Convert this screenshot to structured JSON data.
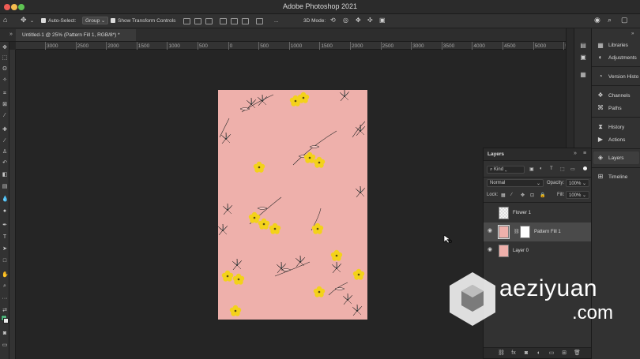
{
  "app": {
    "title": "Adobe Photoshop 2021"
  },
  "options_bar": {
    "auto_select_label": "Auto-Select:",
    "auto_select_value": "Group",
    "transform_controls_label": "Show Transform Controls",
    "mode_3d_label": "3D Mode:",
    "ellipsis": "..."
  },
  "document_tab": {
    "label": "Untitled-1 @ 25% (Pattern Fill 1, RGB/8*) *",
    "close": "×"
  },
  "ruler": {
    "ticks": [
      "3000",
      "2500",
      "2000",
      "1500",
      "1000",
      "500",
      "0",
      "500",
      "1000",
      "1500",
      "2000",
      "2500",
      "3000",
      "3500",
      "4000",
      "4500",
      "5000",
      "5500"
    ]
  },
  "panels": {
    "items": [
      {
        "label": "Libraries",
        "icon": "libraries-icon"
      },
      {
        "label": "Adjustments",
        "icon": "adjustments-icon"
      },
      {
        "label": "Version Histo",
        "icon": "version-history-icon"
      },
      {
        "label": "Channels",
        "icon": "channels-icon"
      },
      {
        "label": "Paths",
        "icon": "paths-icon"
      },
      {
        "label": "History",
        "icon": "history-icon"
      },
      {
        "label": "Actions",
        "icon": "actions-icon"
      },
      {
        "label": "Layers",
        "icon": "layers-icon"
      },
      {
        "label": "Timeline",
        "icon": "timeline-icon"
      }
    ]
  },
  "layers_panel": {
    "title": "Layers",
    "filter_value": "Kind",
    "blend_mode": "Normal",
    "opacity_label": "Opacity:",
    "opacity_value": "100%",
    "lock_label": "Lock:",
    "fill_label": "Fill:",
    "fill_value": "100%",
    "layers": [
      {
        "name": "Flower 1",
        "visible": false,
        "selected": false
      },
      {
        "name": "Pattern Fill 1",
        "visible": true,
        "selected": true
      },
      {
        "name": "Layer 0",
        "visible": true,
        "selected": false
      }
    ],
    "footer_fx": "fx"
  },
  "watermark": {
    "line1": "aeziyuan",
    "line2": ".com"
  },
  "colors": {
    "artboard": "#eeb0ab",
    "flower_yellow": "#f3d21a",
    "selected_row": "#4a4a4a"
  }
}
